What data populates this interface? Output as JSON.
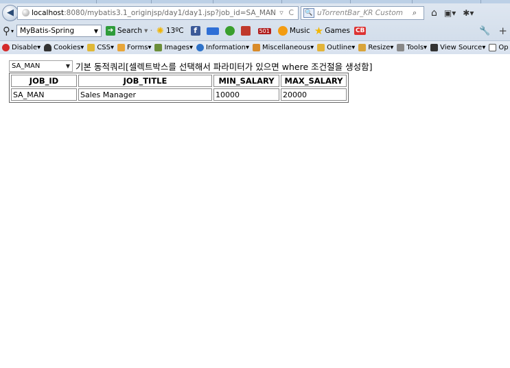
{
  "browser": {
    "url_host": "localhost",
    "url_rest": ":8080/mybatis3.1_originjsp/day1/day1.jsp?job_id=SA_MAN",
    "search_placeholder": "uTorrentBar_KR Custom"
  },
  "toolbar": {
    "profile_select": "MyBatis-Spring",
    "search_label": "Search",
    "weather": "13ºC",
    "badge": "501",
    "music_label": "Music",
    "games_label": "Games",
    "cb_label": "CB"
  },
  "webdev": {
    "items": [
      "Disable",
      "Cookies",
      "CSS",
      "Forms",
      "Images",
      "Information",
      "Miscellaneous",
      "Outline",
      "Resize",
      "Tools",
      "View Source",
      "Op"
    ]
  },
  "page": {
    "select_value": "SA_MAN",
    "description": "기본 동적쿼리[셀렉트박스를 선택해서 파라미터가 있으면 where 조건절을 생성함]",
    "table": {
      "headers": [
        "JOB_ID",
        "JOB_TITLE",
        "MIN_SALARY",
        "MAX_SALARY"
      ],
      "rows": [
        [
          "SA_MAN",
          "Sales Manager",
          "10000",
          "20000"
        ]
      ]
    }
  }
}
